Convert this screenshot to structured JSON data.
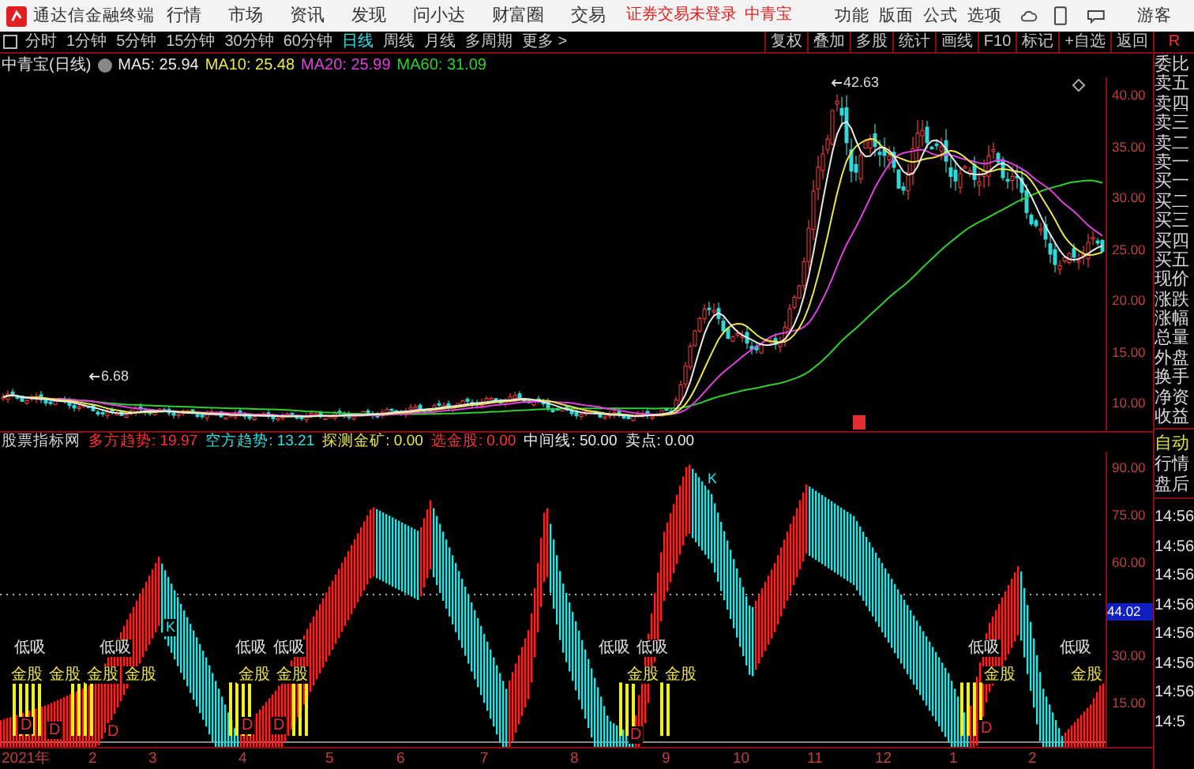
{
  "app": {
    "title": "通达信金融终端"
  },
  "menu": [
    {
      "label": "行情"
    },
    {
      "label": "市场"
    },
    {
      "label": "资讯"
    },
    {
      "label": "发现"
    },
    {
      "label": "问小达"
    },
    {
      "label": "财富圈"
    },
    {
      "label": "交易"
    }
  ],
  "login_status": [
    "证券交易未登录",
    "中青宝"
  ],
  "right_menu": [
    {
      "label": "功能"
    },
    {
      "label": "版面"
    },
    {
      "label": "公式"
    },
    {
      "label": "选项"
    }
  ],
  "user": "游客",
  "periods": [
    {
      "label": "分时",
      "selected": false
    },
    {
      "label": "1分钟",
      "selected": false
    },
    {
      "label": "5分钟",
      "selected": false
    },
    {
      "label": "15分钟",
      "selected": false
    },
    {
      "label": "30分钟",
      "selected": false
    },
    {
      "label": "60分钟",
      "selected": false
    },
    {
      "label": "日线",
      "selected": true
    },
    {
      "label": "周线",
      "selected": false
    },
    {
      "label": "月线",
      "selected": false
    },
    {
      "label": "多周期",
      "selected": false
    },
    {
      "label": "更多 >",
      "selected": false
    }
  ],
  "tools": [
    "复权",
    "叠加",
    "多股",
    "统计",
    "画线",
    "F10",
    "标记",
    "+自选",
    "返回"
  ],
  "corner_label": "R",
  "chart_title": "中青宝(日线)",
  "moving_averages": [
    {
      "text": "MA5: 25.94",
      "color": "#e8e8e8"
    },
    {
      "text": "MA10: 25.48",
      "color": "#e8e84a"
    },
    {
      "text": "MA20: 25.99",
      "color": "#e040e0"
    },
    {
      "text": "MA60: 31.09",
      "color": "#30d030"
    }
  ],
  "price_annotations": [
    "42.63",
    "6.68"
  ],
  "price_axis": [
    "40.00",
    "35.00",
    "30.00",
    "25.00",
    "20.00",
    "15.00",
    "10.00"
  ],
  "indicator_header": [
    {
      "text": "股票指标网",
      "color": "#d0d0d0"
    },
    {
      "text": "多方趋势: 19.97",
      "color": "#ff3030"
    },
    {
      "text": "空方趋势: 13.21",
      "color": "#30e0e0"
    },
    {
      "text": "探测金矿: 0.00",
      "color": "#e8e84a"
    },
    {
      "text": "选金股: 0.00",
      "color": "#ff3030"
    },
    {
      "text": "中间线: 50.00",
      "color": "#e8e8e8"
    },
    {
      "text": "卖点: 0.00",
      "color": "#e8e8e8"
    }
  ],
  "indicator_labels": [
    {
      "text": "低吸",
      "kind": "low"
    },
    {
      "text": "低吸",
      "kind": "low"
    },
    {
      "text": "低吸",
      "kind": "low"
    },
    {
      "text": "低吸",
      "kind": "low"
    },
    {
      "text": "低吸",
      "kind": "low"
    },
    {
      "text": "低吸",
      "kind": "low"
    },
    {
      "text": "低吸",
      "kind": "low"
    },
    {
      "text": "低吸",
      "kind": "low"
    },
    {
      "text": "金股",
      "kind": "gold"
    },
    {
      "text": "金股",
      "kind": "gold"
    },
    {
      "text": "金股",
      "kind": "gold"
    },
    {
      "text": "金股",
      "kind": "gold"
    },
    {
      "text": "金股",
      "kind": "gold"
    },
    {
      "text": "金股",
      "kind": "gold"
    },
    {
      "text": "金股",
      "kind": "gold"
    },
    {
      "text": "金股",
      "kind": "gold"
    },
    {
      "text": "金股",
      "kind": "gold"
    },
    {
      "text": "金股",
      "kind": "gold"
    },
    {
      "text": "K",
      "kind": "k"
    },
    {
      "text": "K",
      "kind": "k"
    },
    {
      "text": "D",
      "kind": "d"
    },
    {
      "text": "D",
      "kind": "d"
    },
    {
      "text": "D",
      "kind": "d"
    },
    {
      "text": "D",
      "kind": "d"
    },
    {
      "text": "D",
      "kind": "d"
    },
    {
      "text": "D",
      "kind": "d"
    },
    {
      "text": "D",
      "kind": "d"
    }
  ],
  "indicator_axis": [
    {
      "text": "90.00",
      "kind": "tick"
    },
    {
      "text": "75.00",
      "kind": "tick"
    },
    {
      "text": "60.00",
      "kind": "tick"
    },
    {
      "text": "44.02",
      "kind": "current"
    },
    {
      "text": "30.00",
      "kind": "tick"
    },
    {
      "text": "15.00",
      "kind": "tick"
    }
  ],
  "time_axis": [
    "2021年",
    "2",
    "3",
    "4",
    "5",
    "6",
    "7",
    "8",
    "9",
    "10",
    "11",
    "12",
    "1",
    "2"
  ],
  "quote_panel": {
    "labels": [
      "委比",
      "卖五",
      "卖四",
      "卖三",
      "卖二",
      "卖一",
      "买一",
      "买二",
      "买三",
      "买四",
      "买五",
      "现价",
      "涨跌",
      "涨幅",
      "总量",
      "外盘",
      "换手",
      "净资",
      "收益"
    ],
    "modes": [
      {
        "text": "自动",
        "selected": true
      },
      {
        "text": "行情",
        "selected": false
      },
      {
        "text": "盘后",
        "selected": false
      }
    ],
    "times": [
      "14:56",
      "14:56",
      "14:56",
      "14:56",
      "14:56",
      "14:56",
      "14:56",
      "14:5"
    ]
  }
}
